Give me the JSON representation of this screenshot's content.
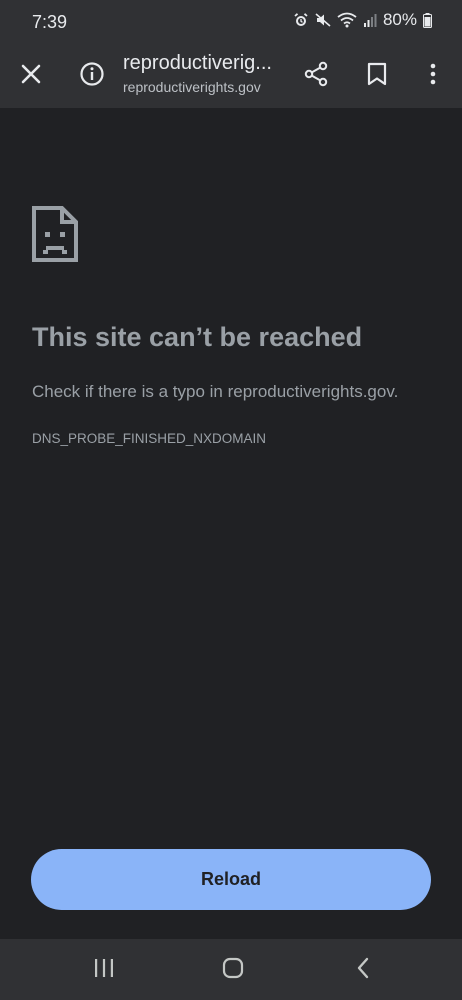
{
  "status_bar": {
    "time": "7:39",
    "battery": "80%"
  },
  "toolbar": {
    "url_title": "reproductiverig...",
    "url_subtitle": "reproductiverights.gov"
  },
  "error": {
    "title": "This site can’t be reached",
    "description": "Check if there is a typo in reproductiverights.gov.",
    "code": "DNS_PROBE_FINISHED_NXDOMAIN"
  },
  "actions": {
    "reload_label": "Reload"
  },
  "icons": {
    "status": [
      "alarm-icon",
      "mute-icon",
      "wifi-icon",
      "signal-icon",
      "battery-icon"
    ],
    "toolbar": [
      "close-icon",
      "info-icon",
      "share-icon",
      "bookmark-icon",
      "more-icon"
    ],
    "error": "sad-document-icon",
    "nav": [
      "recent-apps-icon",
      "home-icon",
      "back-icon"
    ]
  },
  "colors": {
    "background": "#202124",
    "toolbar": "#303134",
    "accent": "#8ab4f8",
    "text_muted": "#9aa0a6"
  }
}
